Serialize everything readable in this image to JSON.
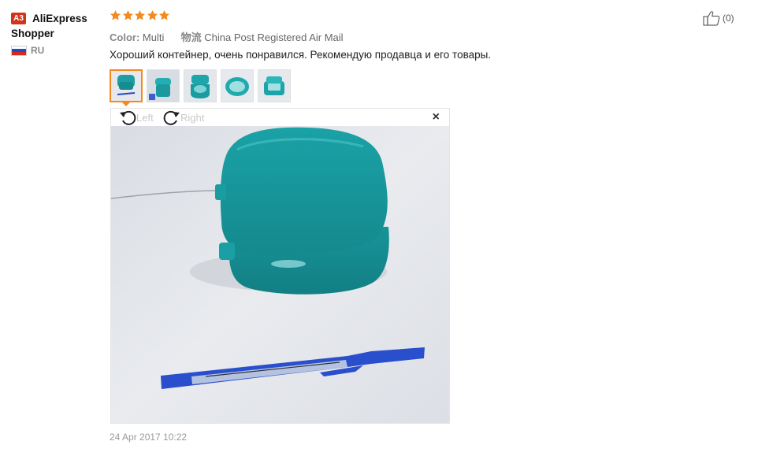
{
  "buyer": {
    "level_badge": "A3",
    "name_line1": "AliExpress",
    "name_line2": "Shopper",
    "country": "RU"
  },
  "rating": {
    "stars": 5,
    "max": 5,
    "color": "#f4891f"
  },
  "helpful": {
    "count": "(0)"
  },
  "attributes": {
    "color_label": "Color:",
    "color_value": "Multi",
    "shipping_label": "物流",
    "shipping_value": "China Post Registered Air Mail"
  },
  "review": {
    "text": "Хороший контейнер, очень понравился. Рекомендую продавца и его товары.",
    "date": "24 Apr 2017 10:22"
  },
  "viewer": {
    "rotate_left_label": "Left",
    "rotate_right_label": "Right",
    "close_label": "×"
  },
  "colors": {
    "accent": "#f4891f",
    "teal": "#1ea3a7",
    "badge": "#d3331b"
  }
}
